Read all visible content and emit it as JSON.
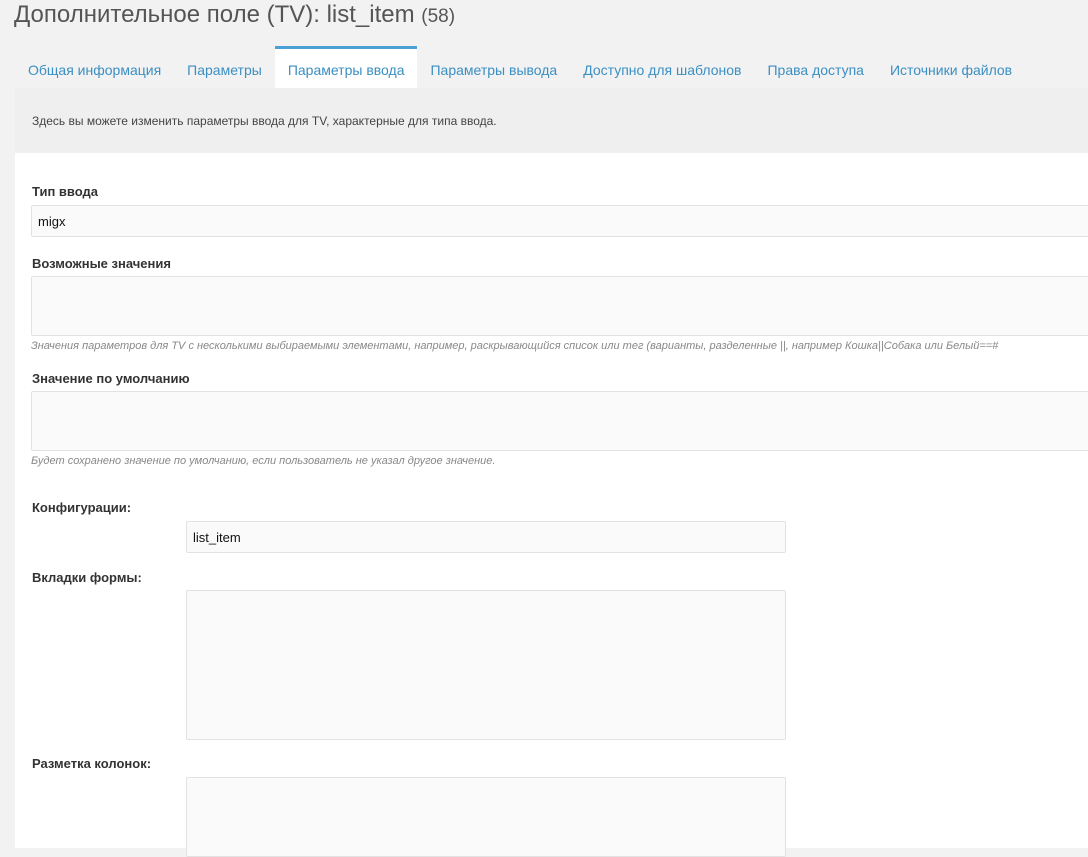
{
  "header": {
    "title": "Дополнительное поле (TV): list_item",
    "id": "(58)"
  },
  "tabs": [
    {
      "label": "Общая информация"
    },
    {
      "label": "Параметры"
    },
    {
      "label": "Параметры ввода"
    },
    {
      "label": "Параметры вывода"
    },
    {
      "label": "Доступно для шаблонов"
    },
    {
      "label": "Права доступа"
    },
    {
      "label": "Источники файлов"
    }
  ],
  "active_tab": "Параметры ввода",
  "panel": {
    "description": "Здесь вы можете изменить параметры ввода для TV, характерные для типа ввода."
  },
  "form": {
    "input_type": {
      "label": "Тип ввода",
      "value": "migx"
    },
    "possible_values": {
      "label": "Возможные значения",
      "value": "",
      "hint": "Значения параметров для TV с несколькими выбираемыми элементами, например, раскрывающийся список или тег (варианты, разделенные ||, например Кошка||Собака или Белый==#"
    },
    "default_value": {
      "label": "Значение по умолчанию",
      "value": "",
      "hint": "Будет сохранено значение по умолчанию, если пользователь не указал другое значение."
    },
    "configs": {
      "label": "Конфигурации:",
      "value": "list_item"
    },
    "form_tabs": {
      "label": "Вкладки формы:",
      "value": ""
    },
    "columns": {
      "label": "Разметка колонок:",
      "value": ""
    }
  }
}
